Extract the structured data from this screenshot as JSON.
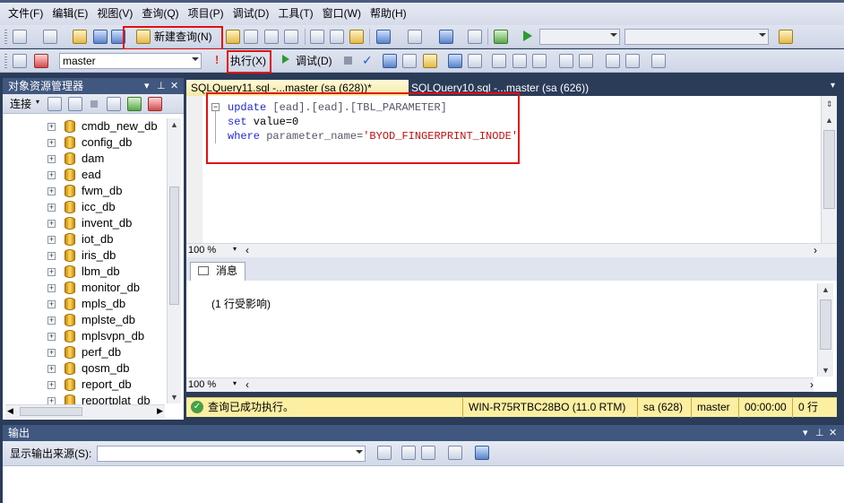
{
  "menubar": {
    "items": [
      "文件(F)",
      "编辑(E)",
      "视图(V)",
      "查询(Q)",
      "项目(P)",
      "调试(D)",
      "工具(T)",
      "窗口(W)",
      "帮助(H)"
    ]
  },
  "toolbar1": {
    "new_query_label": "新建查询(N)"
  },
  "toolbar2": {
    "database": "master",
    "execute_label": "执行(X)",
    "debug_label": "调试(D)"
  },
  "object_explorer": {
    "title": "对象资源管理器",
    "connect_label": "连接",
    "databases": [
      "cmdb_new_db",
      "config_db",
      "dam",
      "ead",
      "fwm_db",
      "icc_db",
      "invent_db",
      "iot_db",
      "iris_db",
      "lbm_db",
      "monitor_db",
      "mpls_db",
      "mplste_db",
      "mplsvpn_db",
      "perf_db",
      "qosm_db",
      "report_db",
      "reportplat_db"
    ]
  },
  "editor": {
    "tabs": [
      "SQLQuery11.sql -...master (sa (628))*",
      "SQLQuery10.sql -...master (sa (626))"
    ],
    "code": {
      "line1_kw": "update",
      "line1_obj": " [ead].[ead].[TBL_PARAMETER]",
      "line2_kw": "set",
      "line2_rest": " value=0",
      "line3_kw": "where",
      "line3_mid": " parameter_name=",
      "line3_str": "'BYOD_FINGERPRINT_INODE'"
    },
    "zoom": "100 %"
  },
  "results": {
    "tab_label": "消息",
    "message": "(1 行受影响)",
    "zoom": "100 %"
  },
  "status": {
    "message": "查询已成功执行。",
    "server": "WIN-R75RTBC28BO (11.0 RTM)",
    "user": "sa (628)",
    "database": "master",
    "time": "00:00:00",
    "rows": "0 行"
  },
  "output": {
    "title": "输出",
    "source_label": "显示输出来源(S):"
  },
  "colors": {
    "ide_background": "#2b3c59",
    "status_bar": "#fcefa2",
    "highlight_box": "#e01010",
    "sql_keyword": "#1e28d8",
    "sql_string": "#c01010"
  }
}
